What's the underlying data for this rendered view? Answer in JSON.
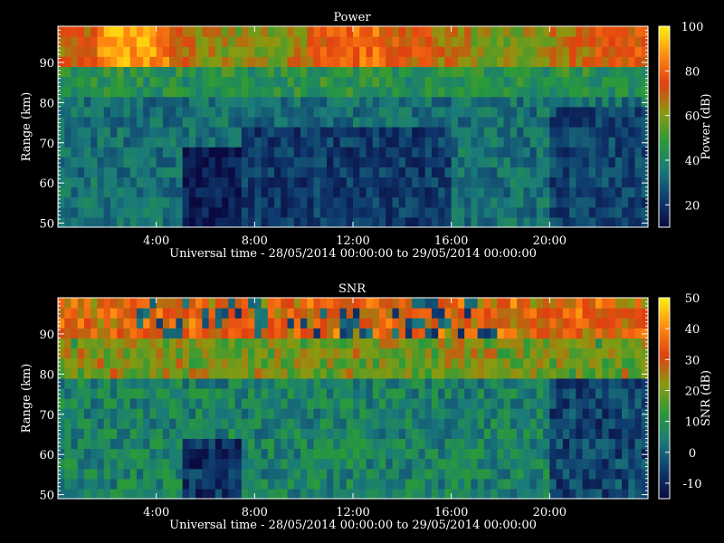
{
  "chart_data": [
    {
      "type": "heatmap",
      "title": "Power",
      "xlabel": "Universal time - 28/05/2014 00:00:00 to 29/05/2014 00:00:00",
      "ylabel": "Range (km)",
      "xlim": [
        0,
        24
      ],
      "ylim": [
        49,
        99
      ],
      "x_ticks": [
        4,
        8,
        12,
        16,
        20
      ],
      "x_tick_labels": [
        "4:00",
        "8:00",
        "12:00",
        "16:00",
        "20:00"
      ],
      "y_ticks": [
        50,
        60,
        70,
        80,
        90
      ],
      "y_tick_labels": [
        "50",
        "60",
        "70",
        "80",
        "90"
      ],
      "colorbar": {
        "label": "Power (dB)",
        "range": [
          10,
          100
        ],
        "ticks": [
          20,
          40,
          60,
          80,
          100
        ],
        "tick_labels": [
          "20",
          "40",
          "60",
          "80",
          "100"
        ]
      },
      "colormap": [
        "#0a0a40",
        "#0f3a6e",
        "#1a7a7a",
        "#2a9a3a",
        "#8a9a10",
        "#e04010",
        "#ff8a10",
        "#ffee10"
      ],
      "data_description_layers": {
        "top_band_km": [
          88,
          99
        ],
        "top_band_db": 70,
        "mid_band_km": [
          82,
          88
        ],
        "mid_band_db": 42,
        "lower_band_km": [
          49,
          82
        ],
        "lower_band_db": 28
      }
    },
    {
      "type": "heatmap",
      "title": "SNR",
      "xlabel": "Universal time - 28/05/2014 00:00:00 to 29/05/2014 00:00:00",
      "ylabel": "Range (km)",
      "xlim": [
        0,
        24
      ],
      "ylim": [
        49,
        99
      ],
      "x_ticks": [
        4,
        8,
        12,
        16,
        20
      ],
      "x_tick_labels": [
        "4:00",
        "8:00",
        "12:00",
        "16:00",
        "20:00"
      ],
      "y_ticks": [
        50,
        60,
        70,
        80,
        90
      ],
      "y_tick_labels": [
        "50",
        "60",
        "70",
        "80",
        "90"
      ],
      "colorbar": {
        "label": "SNR (dB)",
        "range": [
          -15,
          50
        ],
        "ticks": [
          -10,
          0,
          10,
          20,
          30,
          40,
          50
        ],
        "tick_labels": [
          "-10",
          "0",
          "10",
          "20",
          "30",
          "40",
          "50"
        ]
      },
      "colormap": [
        "#0a0a40",
        "#0f3a6e",
        "#1a7a7a",
        "#2a9a3a",
        "#8a9a10",
        "#e04010",
        "#ff8a10",
        "#ffee10"
      ]
    }
  ]
}
